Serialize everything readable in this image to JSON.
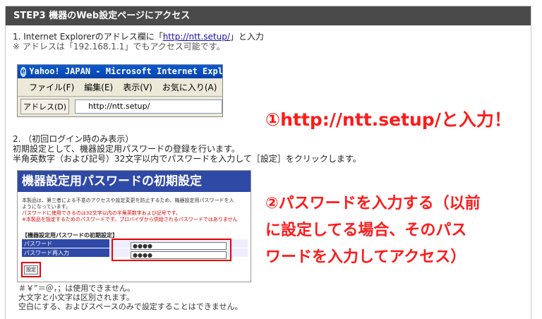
{
  "header": {
    "title": "STEP3 機器のWeb設定ページにアクセス"
  },
  "step1": {
    "line1_prefix": "1. Internet Explorerのアドレス欄に「",
    "link": "http://ntt.setup/",
    "line1_suffix": "」と入力",
    "note": "※ アドレスは「192.168.1.1」でもアクセス可能です。"
  },
  "browser": {
    "title": "Yahoo! JAPAN - Microsoft Internet Explorer",
    "menu": [
      "ファイル(F)",
      "編集(E)",
      "表示(V)",
      "お気に入り(A)",
      "ツ"
    ],
    "address_label": "アドレス(D)",
    "address_value": "http://ntt.setup/"
  },
  "callout1": "①http://ntt.setup/と入力！",
  "step2": {
    "line1": "2. （初回ログイン時のみ表示）",
    "line2": "初期設定として、機器設定用パスワードの登録を行います。",
    "line3": "半角英数字（および記号）32文字以内でパスワードを入力して［設定］をクリックします。"
  },
  "password_form": {
    "title": "機器設定用パスワードの初期設定",
    "desc1": "本製品は、第三者による不意のアクセスや設定変更を防止するため、機器設定用パスワードを入",
    "desc2": "ようになっています。",
    "desc3": "パスワードに使用できるのは32文字以内の半角英数字および記号です。",
    "desc4": "※本製品を設定するためのパスワードです。プロバイダから供給されるパスワードではありません",
    "section": "【機器設定用パスワードの初期設定】",
    "row1_label": "パスワード",
    "row2_label": "パスワード再入力",
    "row1_value": "●●●●",
    "row2_value": "●●●●",
    "button": "設定"
  },
  "callout2": {
    "line1": "②パスワードを入力する（以前",
    "line2": "に設定してる場合、そのパス",
    "line3": "ワードを入力してアクセス）"
  },
  "notes": {
    "line1": "＃￥”＝＠，；は使用できません。",
    "line2": "大文字と小文字は区別されます。",
    "line3": "空白にする、およびスペースのみで設定することはできません。"
  },
  "colors": {
    "header_bg": "#4a4a4a",
    "callout": "#ff1a1a",
    "form_blue": "#2f49a6"
  }
}
